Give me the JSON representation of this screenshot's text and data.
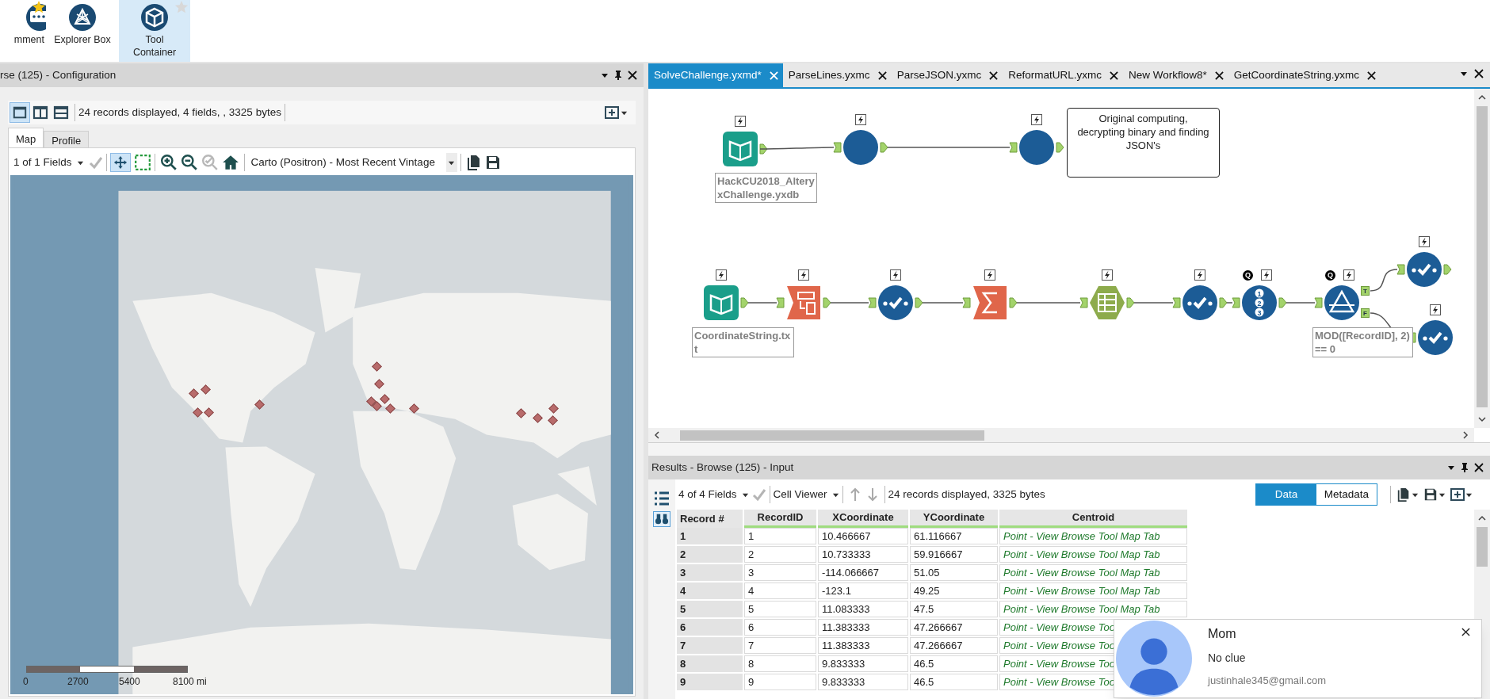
{
  "ribbon": {
    "tools": [
      {
        "label": "mment",
        "kind": "comment",
        "selected": false,
        "star": {
          "color": "#f5c518"
        }
      },
      {
        "label": "Explorer Box",
        "kind": "explorer",
        "selected": false
      },
      {
        "label": "Tool Container",
        "kind": "container",
        "selected": true,
        "star": {
          "color": "#d8d8d8"
        }
      }
    ]
  },
  "configuration": {
    "title": "rse (125) - Configuration",
    "status": "24 records displayed, 4 fields, , 3325 bytes",
    "tabs": [
      {
        "label": "Map",
        "selected": true
      },
      {
        "label": "Profile",
        "selected": false
      }
    ],
    "fields": "1 of 1 Fields",
    "basemap": "Carto (Positron) - Most Recent Vintage",
    "scale_labels": [
      "0",
      "2700",
      "5400",
      "8100 mi"
    ]
  },
  "workflow": {
    "tabs": [
      {
        "label": "SolveChallenge.yxmd*",
        "selected": true
      },
      {
        "label": "ParseLines.yxmc",
        "selected": false
      },
      {
        "label": "ParseJSON.yxmc",
        "selected": false
      },
      {
        "label": "ReformatURL.yxmc",
        "selected": false
      },
      {
        "label": "New Workflow8*",
        "selected": false
      },
      {
        "label": "GetCoordinateString.yxmc",
        "selected": false
      }
    ],
    "nodes": [
      {
        "kind": "input",
        "label": "HackCU2018_AlteryxChallenge.yxdb"
      },
      {
        "kind": "macro"
      },
      {
        "kind": "macro"
      },
      {
        "kind": "input",
        "label": "CoordinateString.txt"
      },
      {
        "kind": "text_to_columns"
      },
      {
        "kind": "select"
      },
      {
        "kind": "summarize"
      },
      {
        "kind": "table"
      },
      {
        "kind": "select"
      },
      {
        "kind": "record_id",
        "badge": "Q",
        "glyphs": [
          "1",
          "2",
          "3"
        ]
      },
      {
        "kind": "filter",
        "badge": "Q",
        "outputs": [
          "T",
          "F"
        ],
        "label": "MOD([RecordID], 2) == 0"
      },
      {
        "kind": "select"
      },
      {
        "kind": "select"
      }
    ],
    "comment": "Original computing, decrypting binary and finding JSON's"
  },
  "results": {
    "title": "Results - Browse (125) - Input",
    "fields": "4 of 4 Fields",
    "viewer": "Cell Viewer",
    "status": "24 records displayed, 3325 bytes",
    "views": [
      {
        "label": "Data",
        "selected": true
      },
      {
        "label": "Metadata",
        "selected": false
      }
    ],
    "table": {
      "columns": [
        "Record #",
        "RecordID",
        "XCoordinate",
        "YCoordinate",
        "Centroid"
      ],
      "rows": [
        [
          "1",
          "1",
          "10.466667",
          "61.116667",
          "Point - View Browse Tool Map Tab"
        ],
        [
          "2",
          "2",
          "10.733333",
          "59.916667",
          "Point - View Browse Tool Map Tab"
        ],
        [
          "3",
          "3",
          "-114.066667",
          "51.05",
          "Point - View Browse Tool Map Tab"
        ],
        [
          "4",
          "4",
          "-123.1",
          "49.25",
          "Point - View Browse Tool Map Tab"
        ],
        [
          "5",
          "5",
          "11.083333",
          "47.5",
          "Point - View Browse Tool Map Tab"
        ],
        [
          "6",
          "6",
          "11.383333",
          "47.266667",
          "Point - View Browse Too"
        ],
        [
          "7",
          "7",
          "11.383333",
          "47.266667",
          "Point - View Browse Too"
        ],
        [
          "8",
          "8",
          "9.833333",
          "46.5",
          "Point - View Browse Too"
        ],
        [
          "9",
          "9",
          "9.833333",
          "46.5",
          "Point - View Browse Too"
        ]
      ]
    }
  },
  "notification": {
    "sender": "Mom",
    "message": "No clue",
    "account": "justinhale345@gmail.com"
  }
}
